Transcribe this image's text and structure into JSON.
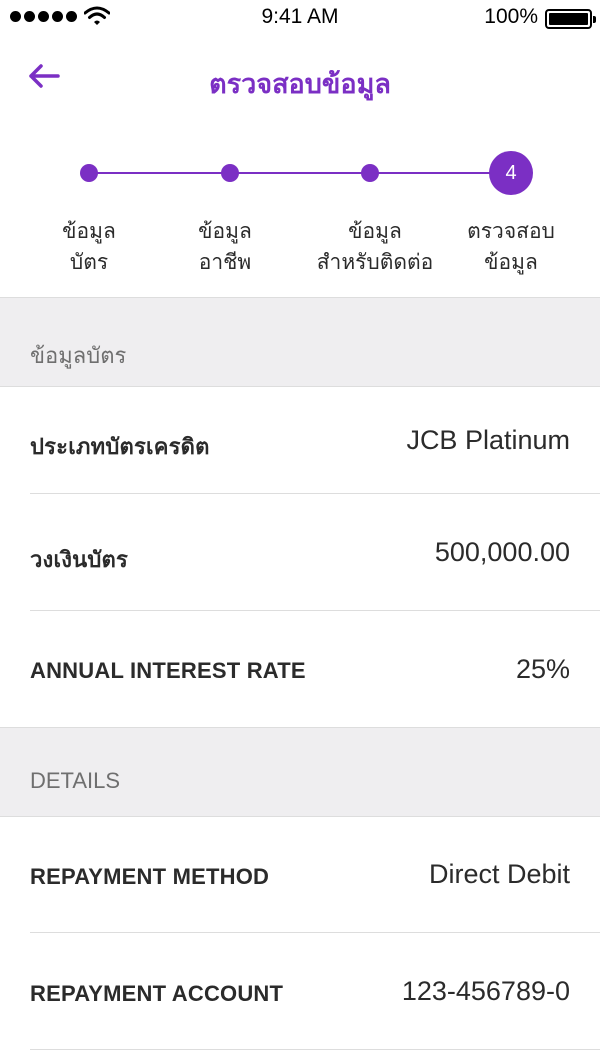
{
  "status_bar": {
    "time": "9:41 AM",
    "battery_percent": "100%",
    "signal_icon": "signal-dots-icon",
    "wifi_icon": "wifi-icon",
    "battery_icon": "battery-full-icon"
  },
  "header": {
    "back_icon": "arrow-left-icon",
    "title": "ตรวจสอบข้อมูล",
    "accent_color": "#7b2fc4"
  },
  "stepper": {
    "current_step": "4",
    "steps": [
      {
        "line1": "ข้อมูล",
        "line2": "บัตร"
      },
      {
        "line1": "ข้อมูล",
        "line2": "อาชีพ"
      },
      {
        "line1": "ข้อมูล",
        "line2": "สำหรับติดต่อ"
      },
      {
        "line1": "ตรวจสอบ",
        "line2": "ข้อมูล"
      }
    ]
  },
  "card_section": {
    "heading": "ข้อมูลบัตร",
    "rows": [
      {
        "label": "ประเภทบัตรเครดิต",
        "value": "JCB Platinum"
      },
      {
        "label": "วงเงินบัตร",
        "value": "500,000.00"
      },
      {
        "label": "ANNUAL INTEREST RATE",
        "value": "25%"
      }
    ]
  },
  "details_section": {
    "heading": "DETAILS",
    "rows": [
      {
        "label": "REPAYMENT METHOD",
        "value": "Direct Debit"
      },
      {
        "label": "REPAYMENT ACCOUNT",
        "value": "123-456789-0"
      }
    ]
  }
}
